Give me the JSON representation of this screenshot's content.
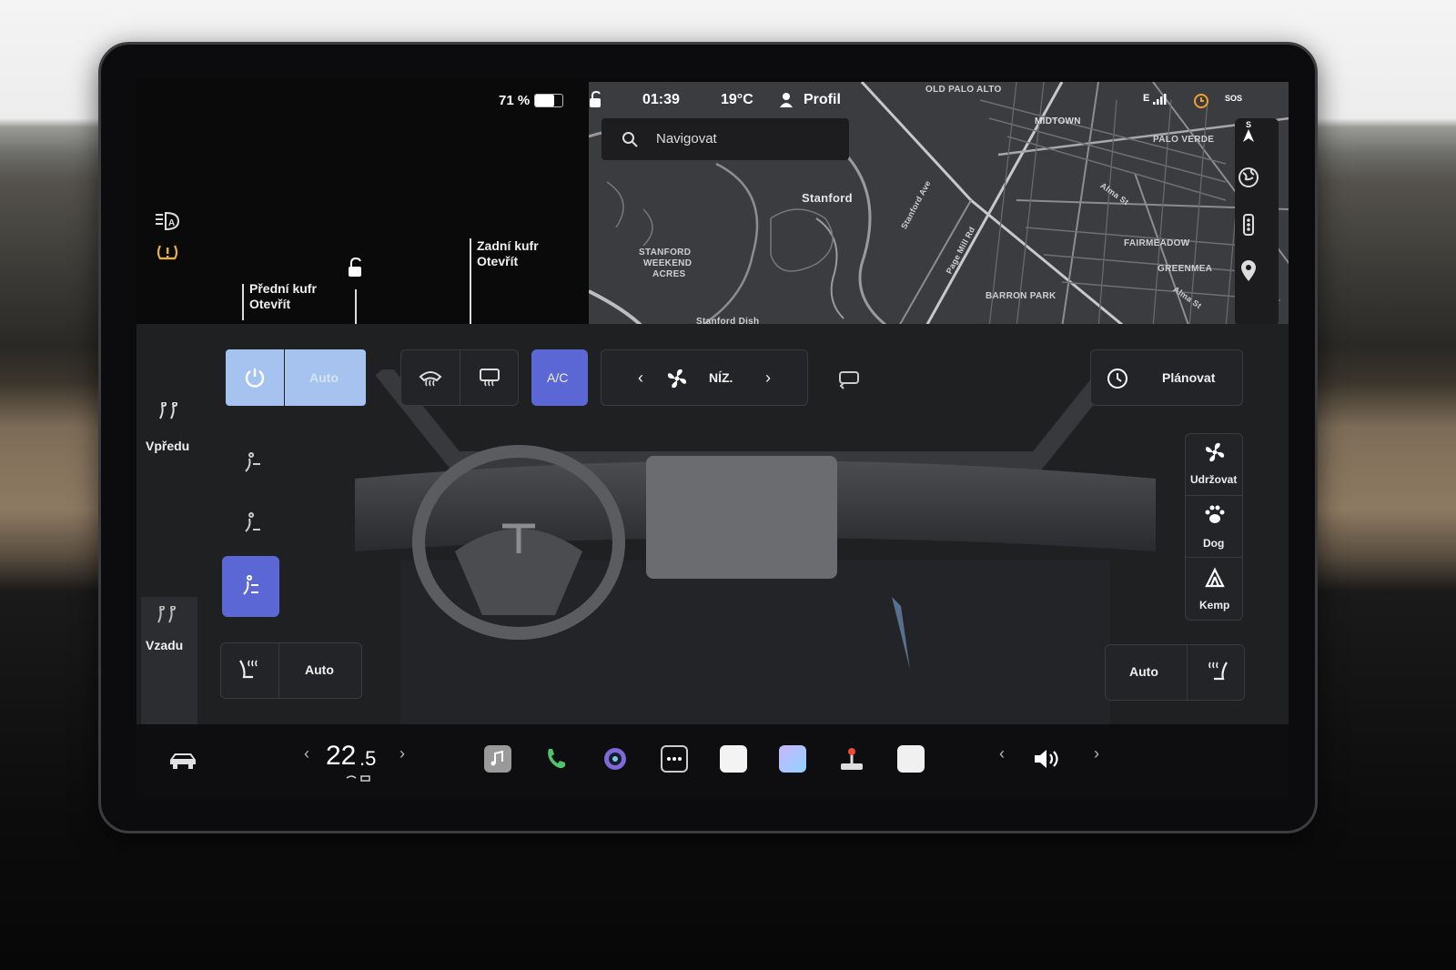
{
  "status": {
    "battery": "71 %",
    "time": "01:39",
    "temperature": "19°C",
    "profile": "Profil",
    "signal": "E",
    "sos": "SOS"
  },
  "vehicle": {
    "front_trunk_title": "Přední kufr",
    "front_trunk_action": "Otevřít",
    "rear_trunk_title": "Zadní kufr",
    "rear_trunk_action": "Otevřít"
  },
  "map": {
    "search_placeholder": "Navigovat",
    "labels": {
      "old_palo_alto": "OLD PALO ALTO",
      "midtown": "MIDTOWN",
      "palo_verde": "PALO VERDE",
      "stanford": "Stanford",
      "stanford_weekend_1": "STANFORD",
      "stanford_weekend_2": "WEEKEND",
      "stanford_weekend_3": "ACRES",
      "fairmeadow": "FAIRMEADOW",
      "greenmeadow": "GREENMEA",
      "barron_park": "BARRON PARK",
      "stanford_dish": "Stanford Dish",
      "stanford_ave": "Stanford Ave",
      "alma_st": "Alma St",
      "alma_st_2": "Alma St",
      "page_mill": "Page Mill Rd",
      "compass": "S"
    }
  },
  "climate": {
    "auto_label": "Auto",
    "ac_label": "A/C",
    "fan_level": "NÍZ.",
    "schedule_label": "Plánovat",
    "front_label": "Vpředu",
    "rear_label": "Vzadu",
    "keep_label": "Udržovat",
    "dog_label": "Dog",
    "camp_label": "Kemp",
    "seat_left_label": "Auto",
    "seat_right_label": "Auto"
  },
  "bottom": {
    "temperature_main": "22",
    "temperature_decimal": ".5"
  }
}
